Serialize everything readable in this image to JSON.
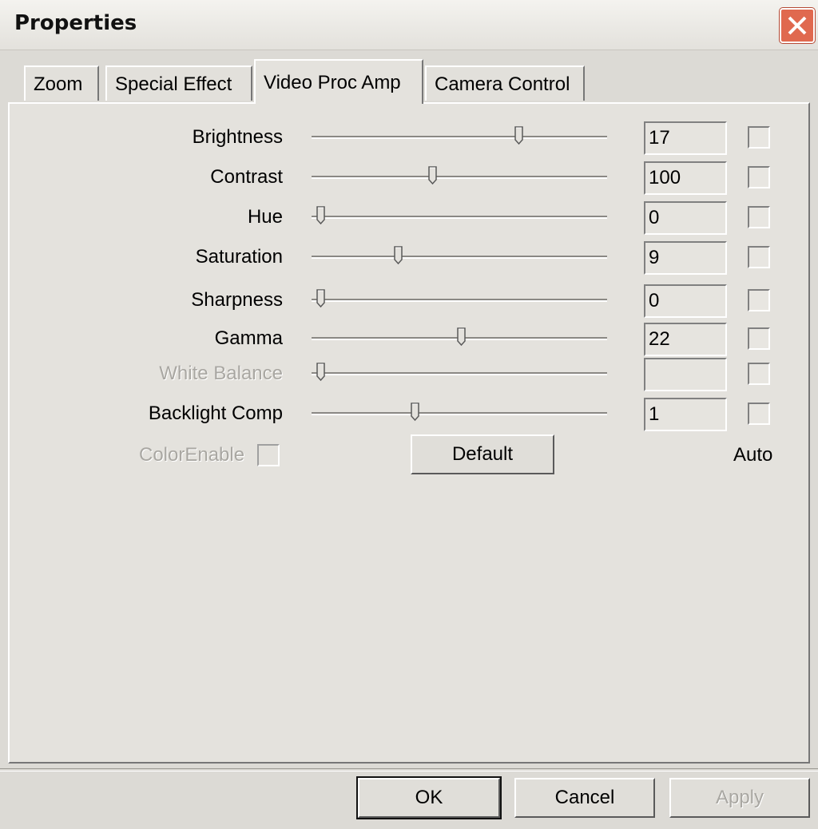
{
  "window": {
    "title": "Properties"
  },
  "tabs": [
    {
      "label": "Zoom"
    },
    {
      "label": "Special Effect"
    },
    {
      "label": "Video Proc Amp",
      "active": true
    },
    {
      "label": "Camera Control"
    }
  ],
  "controls": [
    {
      "label": "Brightness",
      "value": "17",
      "slider": 0.7,
      "enabled": true
    },
    {
      "label": "Contrast",
      "value": "100",
      "slider": 0.4,
      "enabled": true
    },
    {
      "label": "Hue",
      "value": "0",
      "slider": 0.01,
      "enabled": true
    },
    {
      "label": "Saturation",
      "value": "9",
      "slider": 0.28,
      "enabled": true
    },
    {
      "label": "Sharpness",
      "value": "0",
      "slider": 0.01,
      "enabled": true
    },
    {
      "label": "Gamma",
      "value": "22",
      "slider": 0.5,
      "enabled": true
    },
    {
      "label": "White Balance",
      "value": "",
      "slider": 0.01,
      "enabled": false
    },
    {
      "label": "Backlight Comp",
      "value": "1",
      "slider": 0.34,
      "enabled": true
    }
  ],
  "color_enable_label": "ColorEnable",
  "default_button": "Default",
  "auto_label": "Auto",
  "footer": {
    "ok": "OK",
    "cancel": "Cancel",
    "apply": "Apply"
  }
}
